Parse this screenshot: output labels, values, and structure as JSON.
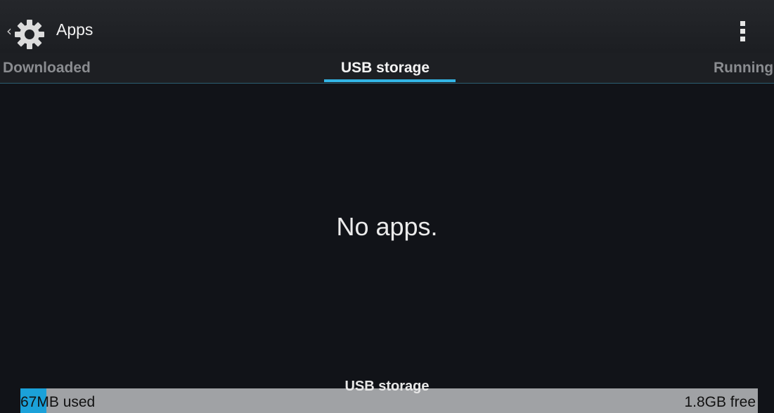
{
  "action_bar": {
    "title": "Apps",
    "up_icon": "chevron-left-icon",
    "app_icon": "gear-icon",
    "overflow_icon": "overflow-menu-icon"
  },
  "tabs": [
    {
      "label": "Downloaded",
      "selected": false
    },
    {
      "label": "USB storage",
      "selected": true
    },
    {
      "label": "Running",
      "selected": false
    }
  ],
  "content": {
    "empty_message": "No apps."
  },
  "storage": {
    "label": "USB storage",
    "used_text": "67MB used",
    "free_text": "1.8GB free",
    "used_fraction": 0.035
  },
  "colors": {
    "accent": "#33b5e5",
    "used_fill": "#1ba1d9",
    "bar_background": "#a0a2a5",
    "screen_background": "#111318"
  }
}
